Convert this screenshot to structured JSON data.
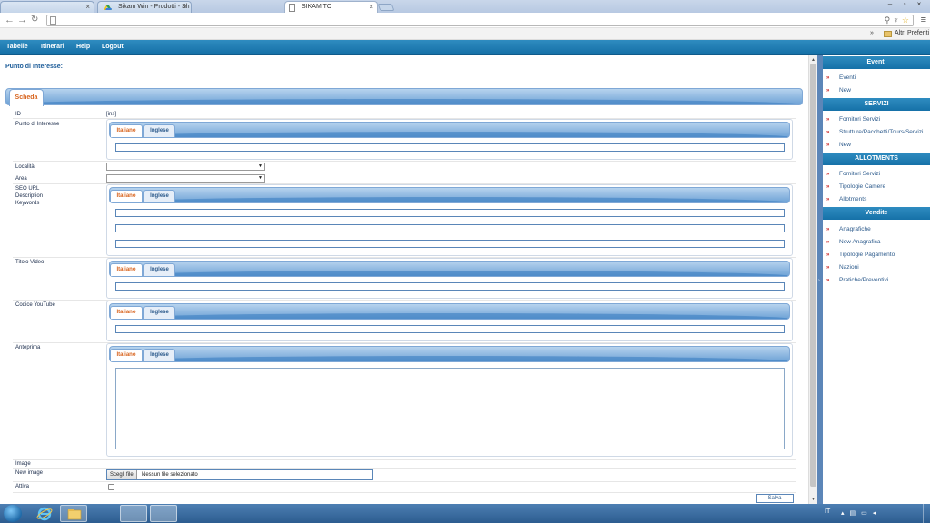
{
  "browser": {
    "tabs": [
      {
        "label": ""
      },
      {
        "label": "Sikam Win - Prodotti - Sh"
      },
      {
        "label": "SIKAM TO"
      }
    ],
    "tab_close": "×",
    "window_buttons": [
      "–",
      "▫",
      "×"
    ],
    "url": "",
    "bookmarks_chevron": "»",
    "bookmarks_folder": "Altri Preferiti"
  },
  "appnav": {
    "items": [
      "Tabelle",
      "Itinerari",
      "Help",
      "Logout"
    ]
  },
  "page": {
    "title": "Punto di Interesse:",
    "section_tab": "Scheda",
    "lang_tabs": {
      "active": "Italiano",
      "other": "Inglese"
    },
    "fields": {
      "id_label": "ID",
      "id_value": "[ins]",
      "poi_label": "Punto di Interesse",
      "localita_label": "Località",
      "area_label": "Area",
      "seo_label1": "SEO URL",
      "seo_label2": "Description",
      "seo_label3": "Keywords",
      "titolo_video_label": "Titolo Video",
      "codice_youtube_label": "Codice YouTube",
      "anteprima_label": "Anteprima",
      "image_label": "Image",
      "new_image_label": "New image",
      "attiva_label": "Attiva"
    },
    "file_input": {
      "button": "Scegli file",
      "status": "Nessun file selezionato"
    },
    "save_button": "Salva"
  },
  "sidebar": {
    "sections": [
      {
        "title": "Eventi",
        "items": [
          "Eventi",
          "New"
        ]
      },
      {
        "title": "SERVIZI",
        "items": [
          "Fornitori Servizi",
          "Strutture/Pacchetti/Tours/Servizi",
          "New"
        ]
      },
      {
        "title": "ALLOTMENTS",
        "items": [
          "Fornitori Servizi",
          "Tipologie Camere",
          "Allotments"
        ]
      },
      {
        "title": "Vendite",
        "items": [
          "Anagrafiche",
          "New Anagrafica",
          "Tipologie Pagamento",
          "Nazioni",
          "Pratiche/Preventivi"
        ]
      }
    ],
    "bullet": "»"
  },
  "taskbar": {
    "language": "IT"
  },
  "colors": {
    "nav_blue": "#1f7db3",
    "tab_active_text": "#d8641e",
    "link_text": "#2d5b8c",
    "bullet_red": "#c81e1e"
  }
}
